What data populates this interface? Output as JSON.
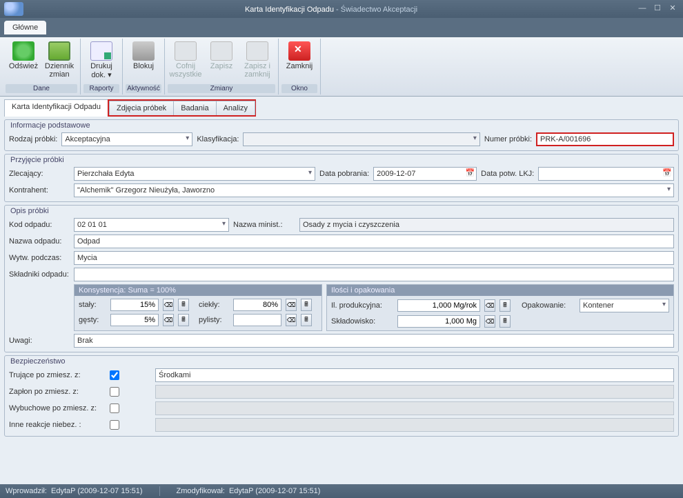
{
  "window": {
    "title_main": "Karta Identyfikacji Odpadu",
    "title_sub": " - Świadectwo Akceptacji"
  },
  "ribbon": {
    "main_tab": "Główne",
    "groups": {
      "dane": {
        "label": "Dane",
        "refresh": "Odśwież",
        "log": "Dziennik zmian"
      },
      "raporty": {
        "label": "Raporty",
        "print": "Drukuj dok. ▾"
      },
      "aktywnosc": {
        "label": "Aktywność",
        "lock": "Blokuj"
      },
      "zmiany": {
        "label": "Zmiany",
        "undo": "Cofnij wszystkie",
        "save": "Zapisz",
        "saveclose": "Zapisz i zamknij"
      },
      "okno": {
        "label": "Okno",
        "close": "Zamknij"
      }
    }
  },
  "subtabs": {
    "t1": "Karta Identyfikacji Odpadu",
    "t2": "Zdjęcia próbek",
    "t3": "Badania",
    "t4": "Analizy"
  },
  "sec_info": {
    "title": "Informacje podstawowe",
    "rodzaj_lbl": "Rodzaj próbki:",
    "rodzaj_val": "Akceptacyjna",
    "klas_lbl": "Klasyfikacja:",
    "klas_val": "",
    "numer_lbl": "Numer próbki:",
    "numer_val": "PRK-A/001696"
  },
  "sec_przyj": {
    "title": "Przyjęcie próbki",
    "zlec_lbl": "Zlecający:",
    "zlec_val": "Pierzchała Edyta",
    "data_pob_lbl": "Data pobrania:",
    "data_pob_val": "2009-12-07",
    "data_potw_lbl": "Data potw. LKJ:",
    "data_potw_val": "",
    "kontr_lbl": "Kontrahent:",
    "kontr_val": "\"Alchemik\" Grzegorz Nieużyła, Jaworzno"
  },
  "sec_opis": {
    "title": "Opis próbki",
    "kod_lbl": "Kod odpadu:",
    "kod_val": "02 01 01",
    "nazwa_min_lbl": "Nazwa minist.:",
    "nazwa_min_val": "Osady z mycia i czyszczenia",
    "nazwa_odp_lbl": "Nazwa odpadu:",
    "nazwa_odp_val": "Odpad",
    "wytw_lbl": "Wytw. podczas:",
    "wytw_val": "Mycia",
    "skl_lbl": "Składniki odpadu:",
    "skl_val": "",
    "kons_title": "Konsystencja: Suma = 100%",
    "kons": {
      "staly_lbl": "stały:",
      "staly_val": "15%",
      "ciekly_lbl": "ciekły:",
      "ciekly_val": "80%",
      "gesty_lbl": "gęsty:",
      "gesty_val": "5%",
      "pylisty_lbl": "pylisty:",
      "pylisty_val": ""
    },
    "ilosci_title": "Ilości i opakowania",
    "ilosci": {
      "prod_lbl": "Il. produkcyjna:",
      "prod_val": "1,000 Mg/rok",
      "sklad_lbl": "Składowisko:",
      "sklad_val": "1,000 Mg",
      "opak_lbl": "Opakowanie:",
      "opak_val": "Kontener"
    },
    "uwagi_lbl": "Uwagi:",
    "uwagi_val": "Brak"
  },
  "sec_bezp": {
    "title": "Bezpieczeństwo",
    "truj_lbl": "Trujące po zmiesz. z:",
    "truj_chk": true,
    "truj_val": "Środkami",
    "zaplon_lbl": "Zapłon po zmiesz. z:",
    "wybuch_lbl": "Wybuchowe po zmiesz. z:",
    "inne_lbl": "Inne reakcje niebez. :"
  },
  "status": {
    "wpr_lbl": "Wprowadził:",
    "wpr_val": "EdytaP (2009-12-07 15:51)",
    "zmod_lbl": "Zmodyfikował:",
    "zmod_val": "EdytaP (2009-12-07 15:51)"
  }
}
